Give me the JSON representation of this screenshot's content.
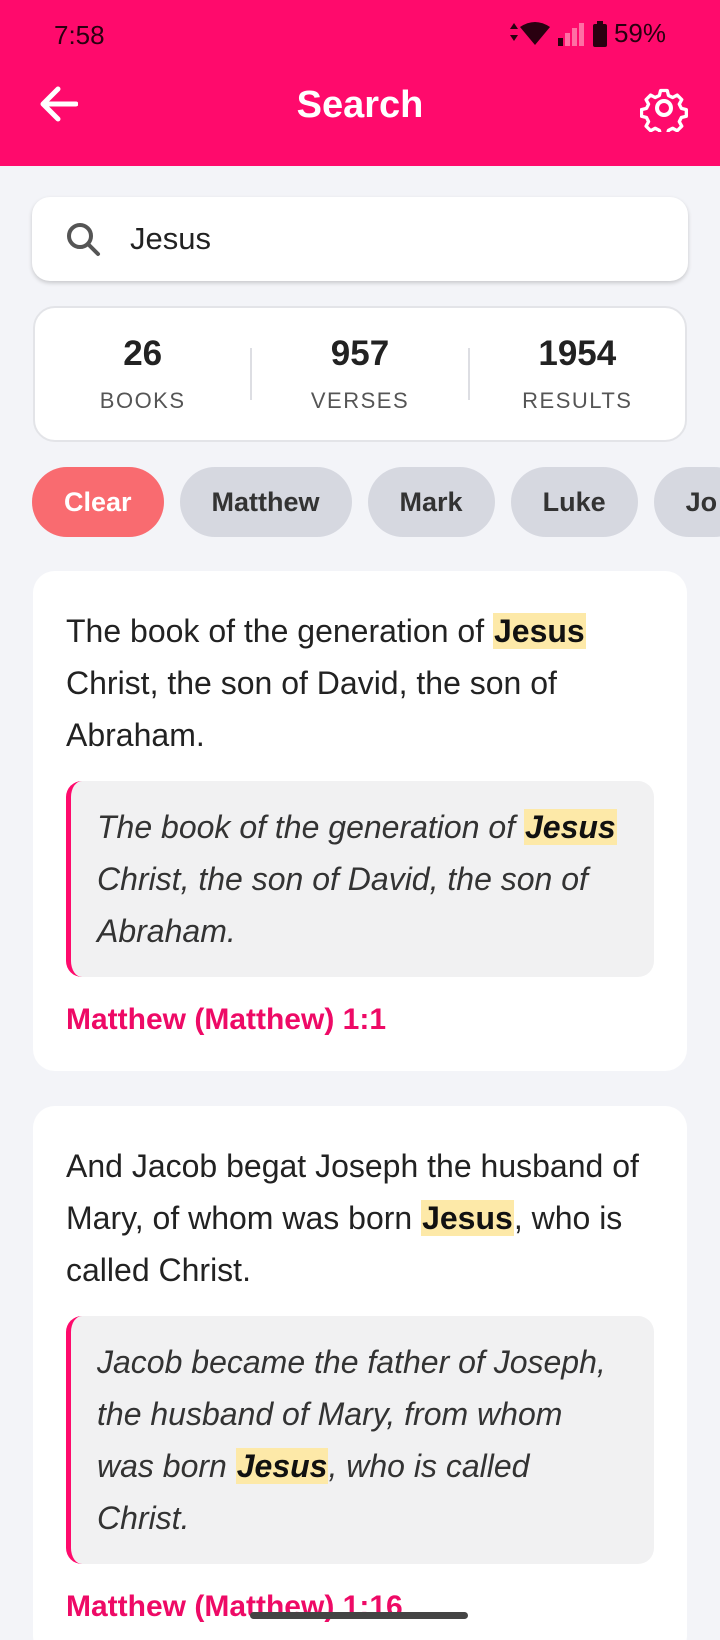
{
  "status": {
    "time": "7:58",
    "battery": "59%"
  },
  "header": {
    "title": "Search"
  },
  "search": {
    "value": "Jesus",
    "placeholder": ""
  },
  "stats": [
    {
      "number": "26",
      "label": "BOOKS"
    },
    {
      "number": "957",
      "label": "VERSES"
    },
    {
      "number": "1954",
      "label": "RESULTS"
    }
  ],
  "chips": [
    "Clear",
    "Matthew",
    "Mark",
    "Luke",
    "Jo"
  ],
  "results": [
    {
      "verse_pre": "The book of the generation of ",
      "verse_hl": "Jesus",
      "verse_post": " Christ, the son of David, the son of Abraham.",
      "alt_pre": "The book of the generation of ",
      "alt_hl": "Jesus",
      "alt_post": " Christ, the son of David, the son of Abraham.",
      "reference": "Matthew (Matthew) 1:1"
    },
    {
      "verse_pre": "And Jacob begat Joseph the husband of Mary, of whom was born ",
      "verse_hl": "Jesus",
      "verse_post": ", who is called Christ.",
      "alt_pre": "Jacob became the father of Joseph, the husband of Mary, from whom was born ",
      "alt_hl": "Jesus",
      "alt_post": ", who is called Christ.",
      "reference": "Matthew (Matthew) 1:16"
    }
  ],
  "colors": {
    "accent": "#ff0a6c",
    "clear_chip": "#f96b70",
    "highlight": "#fde9a8",
    "chip": "#d6d8e0"
  },
  "icons": [
    "back-arrow-icon",
    "gear-icon",
    "search-icon",
    "wifi-icon",
    "signal-icon",
    "battery-icon"
  ]
}
